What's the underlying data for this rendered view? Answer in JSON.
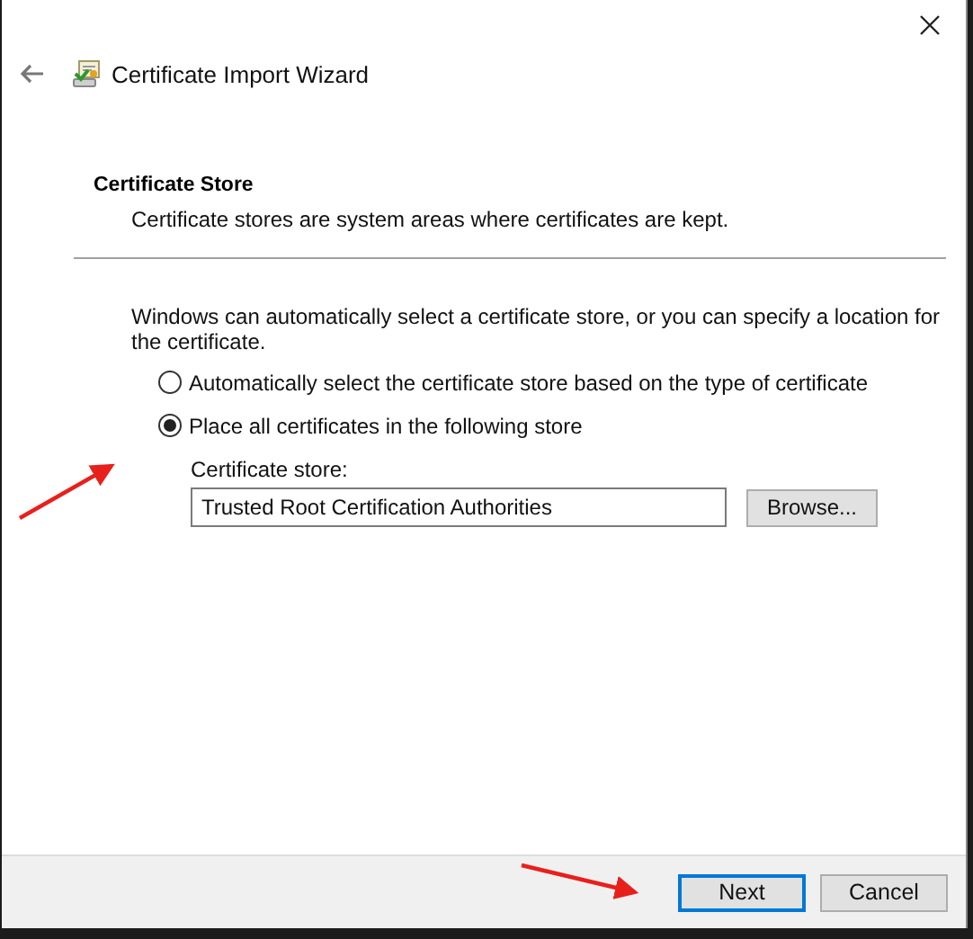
{
  "window": {
    "title": "Certificate Import Wizard"
  },
  "page": {
    "heading": "Certificate Store",
    "description": "Certificate stores are system areas where certificates are kept."
  },
  "instruction": "Windows can automatically select a certificate store, or you can specify a location for the certificate.",
  "options": [
    {
      "label": "Automatically select the certificate store based on the type of certificate",
      "selected": false
    },
    {
      "label": "Place all certificates in the following store",
      "selected": true
    }
  ],
  "store_field": {
    "label": "Certificate store:",
    "value": "Trusted Root Certification Authorities"
  },
  "browse_button": "Browse...",
  "buttons": [
    {
      "label": "Next",
      "default": true
    },
    {
      "label": "Cancel",
      "default": false
    }
  ]
}
